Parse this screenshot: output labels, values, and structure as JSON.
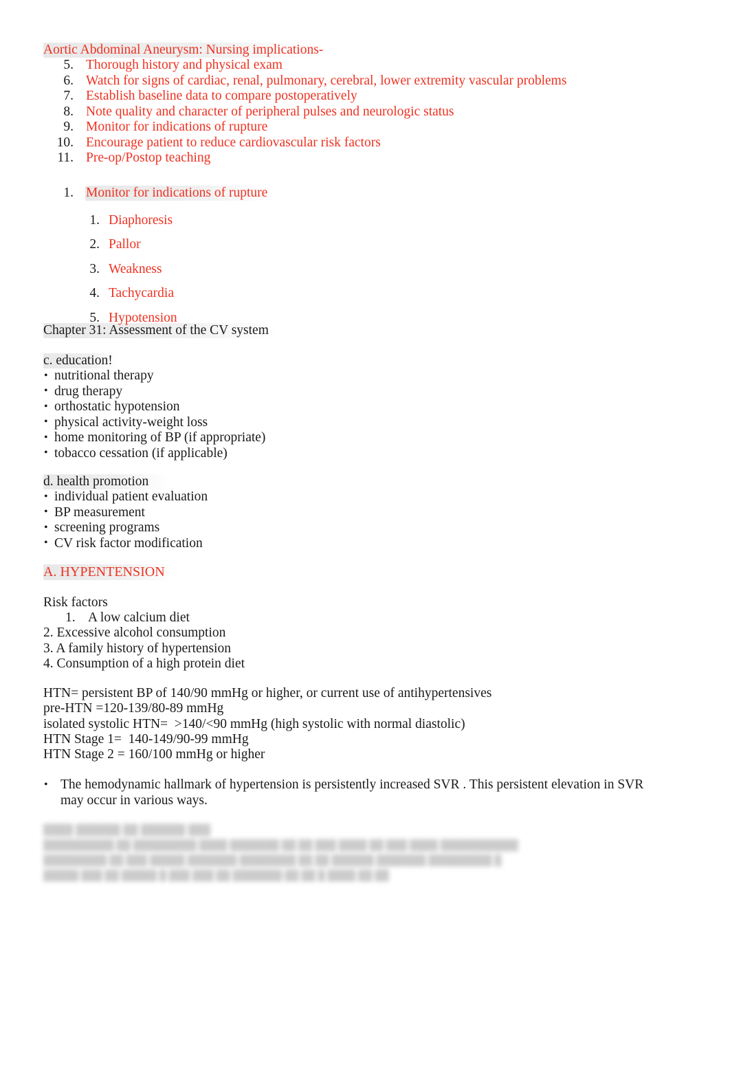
{
  "document": {
    "colors": {
      "accent_red": "#ee3222",
      "body_black": "#1a1a1a",
      "page_background": "#ffffff"
    },
    "aaa_section": {
      "heading": "Aortic Abdominal Aneurysm: Nursing implications-",
      "items": [
        {
          "marker": "5.",
          "text": "Thorough history and physical exam"
        },
        {
          "marker": "6.",
          "text": "Watch for signs of cardiac, renal, pulmonary, cerebral, lower extremity vascular problems"
        },
        {
          "marker": "7.",
          "text": "Establish baseline data to compare postoperatively"
        },
        {
          "marker": "8.",
          "text": "Note quality and character of peripheral pulses and neurologic status"
        },
        {
          "marker": "9.",
          "text": "Monitor for indications of rupture"
        },
        {
          "marker": "10.",
          "text": "Encourage patient to reduce cardiovascular risk factors"
        },
        {
          "marker": "11.",
          "text": "Pre-op/Postop teaching"
        }
      ]
    },
    "rupture_section": {
      "items": [
        {
          "marker": "1.",
          "text": "Monitor for indications of rupture"
        }
      ],
      "signs": [
        {
          "marker": "1.",
          "text": "Diaphoresis"
        },
        {
          "marker": "2.",
          "text": "Pallor"
        },
        {
          "marker": "3.",
          "text": "Weakness"
        },
        {
          "marker": "4.",
          "text": "Tachycardia"
        },
        {
          "marker": "5.",
          "text": "Hypotension"
        }
      ]
    },
    "chapter_line": "Chapter 31: Assessment of the CV system",
    "education": {
      "heading": "c. education!",
      "bullet_glyph": "•",
      "items": [
        "nutritional therapy",
        "drug therapy",
        "orthostatic hypotension",
        "physical activity-weight loss",
        "home monitoring of BP (if appropriate)",
        "tobacco cessation (if applicable)"
      ]
    },
    "health_promotion": {
      "heading": "d. health promotion",
      "bullet_glyph": "•",
      "items": [
        "individual patient evaluation",
        "BP measurement",
        "screening programs",
        "CV risk factor modification"
      ]
    },
    "hypertension": {
      "heading": "A. HYPENTENSION",
      "risk_factors_label": "Risk factors",
      "risk_factor_first": "1.    A low calcium diet",
      "risk_factors_rest": [
        "2. Excessive alcohol consumption",
        "3. A family history of hypertension",
        "4. Consumption of a high protein diet"
      ],
      "definitions": [
        "HTN= persistent BP of 140/90 mmHg or higher, or current use of antihypertensives",
        "pre-HTN =120-139/80-89 mmHg",
        "isolated systolic HTN=  >140/<90 mmHg (high systolic with normal diastolic)",
        "HTN Stage 1=  140-149/90-99 mmHg",
        "HTN Stage 2 = 160/100 mmHg or higher"
      ],
      "hallmark_bullet": {
        "glyph": "•",
        "text": "The hemodynamic hallmark of hypertension is persistently increased SVR   . This persistent elevation in SVR may occur in various ways."
      }
    },
    "faded_footer": {
      "title": "████ ██████ ██ ██████ ███",
      "lines": [
        "██████████ ██ █████████ ████ ███████ ██ ██ ███ ████ ██ ███ ████ ███████████",
        "█████████ ██ ███ █████ ███████ ████████ ██ ██ ██████ ███████ █████████ █",
        "█████ ███ ██ █████ █ ███ ███ ██ ███████ ██ ██ █ ████ ██ ██"
      ]
    }
  }
}
